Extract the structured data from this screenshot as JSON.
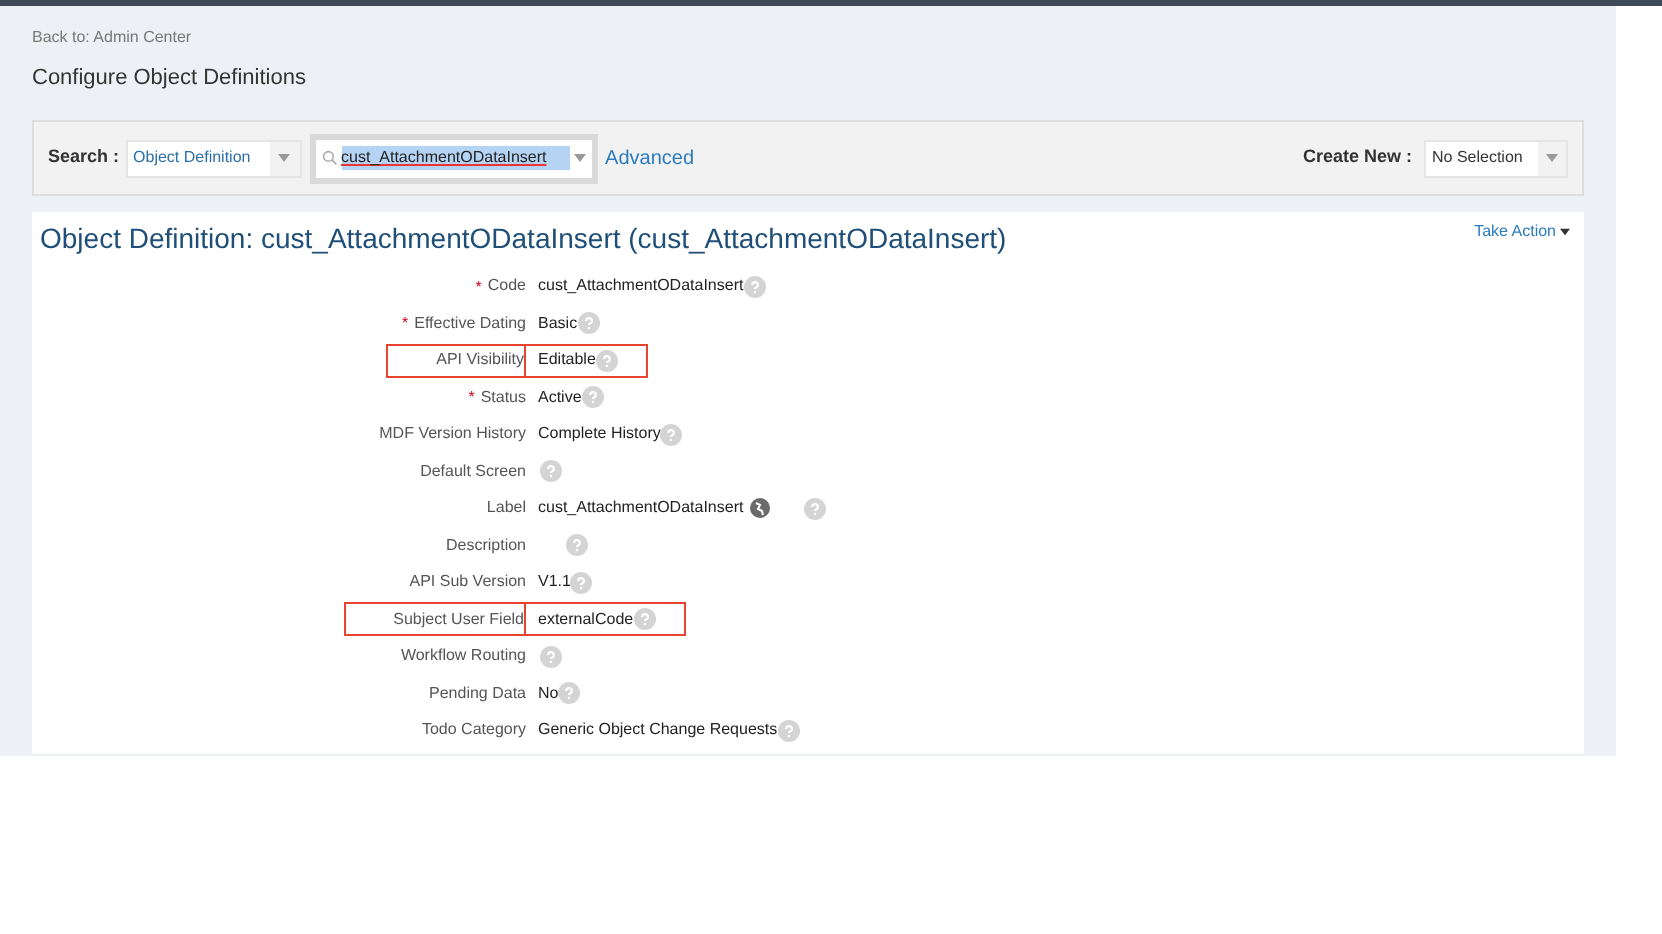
{
  "breadcrumb": "Back to: Admin Center",
  "page_title": "Configure Object Definitions",
  "search_bar": {
    "label": "Search :",
    "type_select": "Object Definition",
    "query": "cust_AttachmentODataInsert",
    "advanced_link": "Advanced",
    "create_label": "Create New :",
    "create_select": "No Selection"
  },
  "object_title": "Object Definition: cust_AttachmentODataInsert (cust_AttachmentODataInsert)",
  "take_action": "Take Action",
  "fields": [
    {
      "marker": "*",
      "label": "Code",
      "value": "cust_AttachmentODataInsert",
      "highlighted": false,
      "translatable": false
    },
    {
      "marker": "*",
      "label": "Effective Dating",
      "value": "Basic",
      "highlighted": false,
      "translatable": false
    },
    {
      "label": "API Visibility",
      "value": "Editable",
      "highlighted": true,
      "translatable": false
    },
    {
      "marker": "*",
      "label": "Status",
      "value": "Active",
      "highlighted": false,
      "translatable": false
    },
    {
      "label": "MDF Version History",
      "value": "Complete History",
      "highlighted": false,
      "translatable": false
    },
    {
      "label": "Default Screen",
      "highlighted": false,
      "translatable": false
    },
    {
      "label": "Label",
      "value": "cust_AttachmentODataInsert",
      "highlighted": false,
      "translatable": true
    },
    {
      "label": "Description",
      "highlighted": false,
      "translatable": false
    },
    {
      "label": "API Sub Version",
      "value": "V1.1",
      "highlighted": false,
      "translatable": false
    },
    {
      "label": "Subject User Field",
      "value": "externalCode",
      "highlighted": true,
      "translatable": false
    },
    {
      "label": "Workflow Routing",
      "highlighted": false,
      "translatable": false
    },
    {
      "label": "Pending Data",
      "value": "No",
      "highlighted": false,
      "translatable": false
    },
    {
      "label": "Todo Category",
      "value": "Generic Object Change Requests",
      "highlighted": false,
      "translatable": false
    }
  ]
}
